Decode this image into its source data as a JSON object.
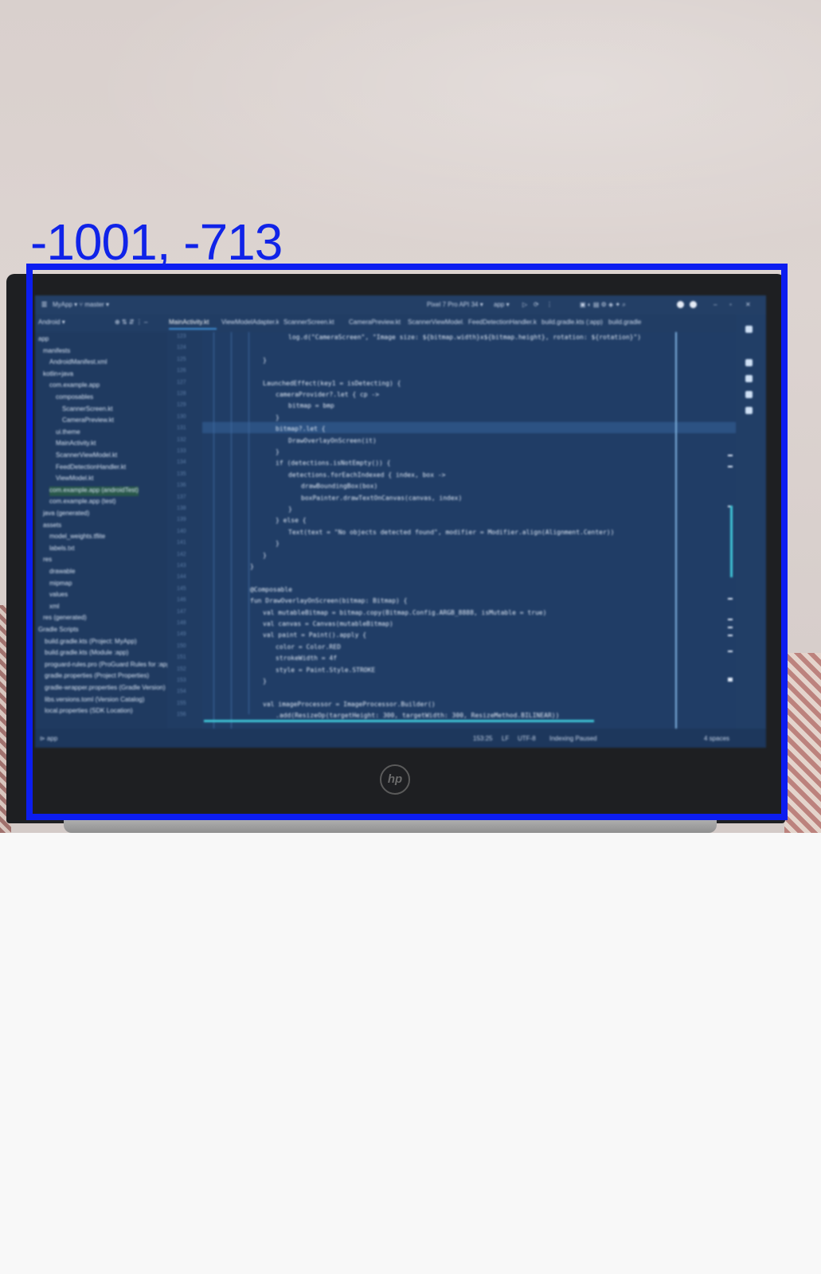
{
  "overlay": {
    "coordinate_label": "-1001, -713",
    "box_color": "#0c1df0"
  },
  "device": {
    "brand_logo": "hp"
  },
  "ide": {
    "titlebar": {
      "project_menu": "MyApp ▾ ⑂ master ▾",
      "device_selector": "Pixel 7 Pro API 34 ▾",
      "run_config": "app ▾"
    },
    "tabs": [
      {
        "label": "MainActivity.kt",
        "active": true
      },
      {
        "label": "ViewModelAdapter.kt",
        "active": false
      },
      {
        "label": "ScannerScreen.kt",
        "active": false
      },
      {
        "label": "CameraPreview.kt",
        "active": false
      },
      {
        "label": "ScannerViewModel.kt",
        "active": false
      },
      {
        "label": "FeedDetectionHandler.kt",
        "active": false
      },
      {
        "label": "build.gradle.kts (:app)",
        "active": false
      },
      {
        "label": "build.gradle",
        "active": false
      }
    ],
    "sidebar_header": "Android ▾",
    "tree": [
      "app",
      "manifests",
      "AndroidManifest.xml",
      "kotlin+java",
      "com.example.app",
      "composables",
      "ScannerScreen.kt",
      "CameraPreview.kt",
      "ui.theme",
      "MainActivity.kt",
      "ScannerViewModel.kt",
      "FeedDetectionHandler.kt",
      "ViewModel.kt",
      "com.example.app (androidTest)",
      "com.example.app (test)",
      "java (generated)",
      "assets",
      "model_weights.tflite",
      "labels.txt",
      "res",
      "drawable",
      "mipmap",
      "values",
      "xml",
      "res (generated)",
      "Gradle Scripts",
      "build.gradle.kts (Project: MyApp)",
      "build.gradle.kts (Module :app)",
      "proguard-rules.pro (ProGuard Rules for :app)",
      "gradle.properties (Project Properties)",
      "gradle-wrapper.properties (Gradle Version)",
      "libs.versions.toml (Version Catalog)",
      "local.properties (SDK Location)"
    ],
    "code_lines": [
      {
        "indent": 6,
        "text": "log.d(\"CameraScreen\", \"Image size: ${bitmap.width}x${bitmap.height}, rotation: ${rotation}\")"
      },
      {
        "indent": 0,
        "text": ""
      },
      {
        "indent": 2,
        "text": "}"
      },
      {
        "indent": 0,
        "text": ""
      },
      {
        "indent": 2,
        "text": "LaunchedEffect(key1 = isDetecting) {"
      },
      {
        "indent": 4,
        "text": "cameraProvider?.let { cp ->"
      },
      {
        "indent": 6,
        "text": "bitmap = bmp"
      },
      {
        "indent": 4,
        "text": "}"
      },
      {
        "indent": 4,
        "text": "bitmap?.let {"
      },
      {
        "indent": 6,
        "text": "DrawOverlayOnScreen(it)"
      },
      {
        "indent": 4,
        "text": "}"
      },
      {
        "indent": 4,
        "text": "if (detections.isNotEmpty()) {"
      },
      {
        "indent": 6,
        "text": "detections.forEachIndexed { index, box ->"
      },
      {
        "indent": 8,
        "text": "drawBoundingBox(box)"
      },
      {
        "indent": 8,
        "text": "boxPainter.drawTextOnCanvas(canvas, index)"
      },
      {
        "indent": 6,
        "text": "}"
      },
      {
        "indent": 4,
        "text": "} else {"
      },
      {
        "indent": 6,
        "text": "Text(text = \"No objects detected found\", modifier = Modifier.align(Alignment.Center))"
      },
      {
        "indent": 4,
        "text": "}"
      },
      {
        "indent": 2,
        "text": "}"
      },
      {
        "indent": 0,
        "text": "}"
      },
      {
        "indent": 0,
        "text": ""
      },
      {
        "indent": 0,
        "text": "@Composable"
      },
      {
        "indent": 0,
        "text": "fun DrawOverlayOnScreen(bitmap: Bitmap) {"
      },
      {
        "indent": 2,
        "text": "val mutableBitmap = bitmap.copy(Bitmap.Config.ARGB_8888, isMutable = true)"
      },
      {
        "indent": 2,
        "text": "val canvas = Canvas(mutableBitmap)"
      },
      {
        "indent": 2,
        "text": "val paint = Paint().apply {"
      },
      {
        "indent": 4,
        "text": "color = Color.RED"
      },
      {
        "indent": 4,
        "text": "strokeWidth = 4f"
      },
      {
        "indent": 4,
        "text": "style = Paint.Style.STROKE"
      },
      {
        "indent": 2,
        "text": "}"
      },
      {
        "indent": 0,
        "text": ""
      },
      {
        "indent": 2,
        "text": "val imageProcessor = ImageProcessor.Builder()"
      },
      {
        "indent": 4,
        "text": ".add(ResizeOp(targetHeight: 300, targetWidth: 300, ResizeMethod.BILINEAR))"
      }
    ],
    "line_numbers_start": 123,
    "status": {
      "left": "⊳ app",
      "position": "153:25",
      "encoding": "UTF-8",
      "indent": "4 spaces",
      "line_sep": "LF",
      "branch": "Indexing Paused"
    }
  }
}
